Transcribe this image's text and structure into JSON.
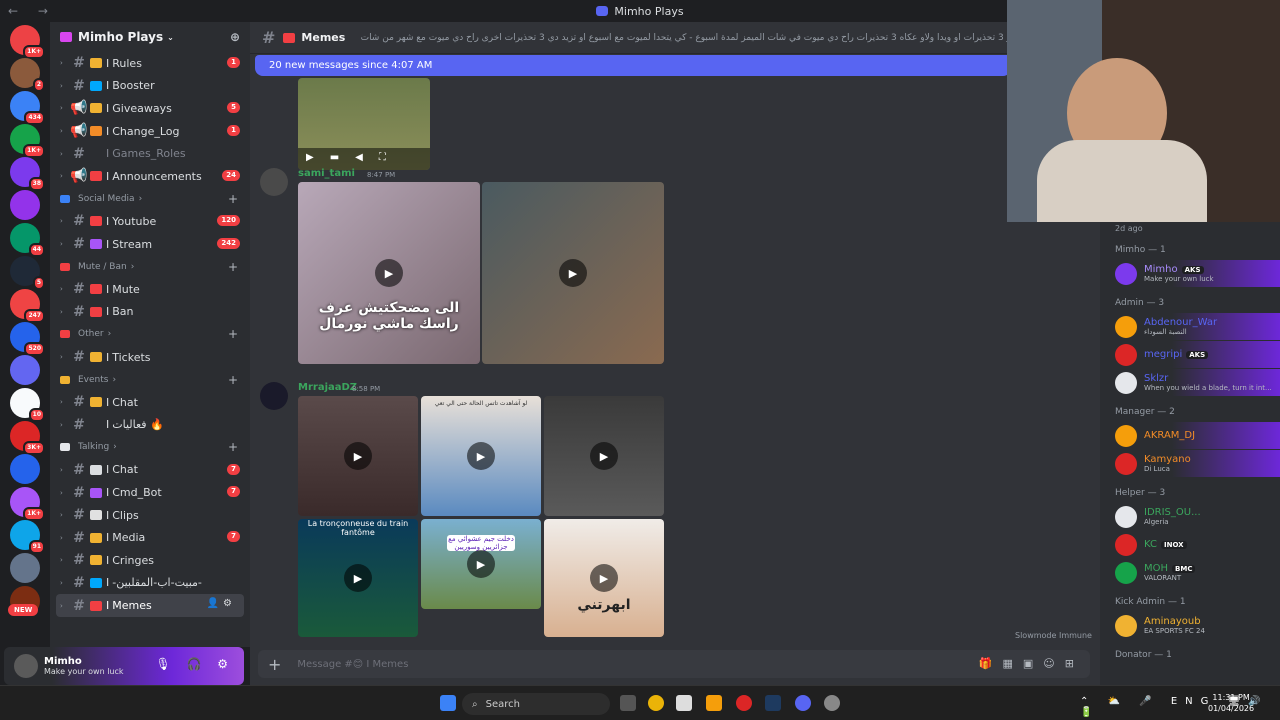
{
  "window": {
    "title": "Mimho Plays"
  },
  "guilds": {
    "badges": [
      "1K+",
      "2",
      "434",
      "1K+",
      "38",
      "",
      "44",
      "5",
      "247",
      "520",
      "",
      "10",
      "3K+",
      "",
      "1K+",
      "91",
      "",
      ""
    ],
    "new_label": "NEW"
  },
  "server": {
    "name": "Mimho Plays"
  },
  "channels": [
    {
      "label": "Rules",
      "type": "text",
      "badge": "1",
      "color": "#f0b232"
    },
    {
      "label": "Booster",
      "type": "text",
      "badge": "",
      "color": "#00a8fc"
    },
    {
      "label": "Giveaways",
      "type": "announce",
      "badge": "5",
      "color": "#f0b232"
    },
    {
      "label": "Change_Log",
      "type": "announce",
      "badge": "1",
      "color": "#f28c28"
    },
    {
      "label": "Games_Roles",
      "type": "text",
      "badge": "",
      "color": "",
      "muted": true
    },
    {
      "label": "Announcements",
      "type": "announce",
      "badge": "24",
      "color": "#f23f43"
    }
  ],
  "categories": {
    "social": {
      "label": "Social Media",
      "items": [
        {
          "label": "Youtube",
          "badge": "120",
          "color": "#f23f43"
        },
        {
          "label": "Stream",
          "badge": "242",
          "color": "#a855f7"
        }
      ]
    },
    "mute": {
      "label": "Mute / Ban",
      "items": [
        {
          "label": "Mute",
          "color": "#f23f43"
        },
        {
          "label": "Ban",
          "color": "#f23f43"
        }
      ]
    },
    "other": {
      "label": "Other",
      "items": [
        {
          "label": "Tickets",
          "color": "#f0b232"
        }
      ]
    },
    "events": {
      "label": "Events",
      "items": [
        {
          "label": "Chat",
          "color": "#f0b232"
        },
        {
          "label": "فعاليات 🔥",
          "color": ""
        }
      ]
    },
    "talking": {
      "label": "Talking",
      "items": [
        {
          "label": "Chat",
          "badge": "7",
          "color": "#dbdee1"
        },
        {
          "label": "Cmd_Bot",
          "badge": "7",
          "color": "#a855f7"
        },
        {
          "label": "Clips",
          "badge": "",
          "color": "#e1e1e1"
        },
        {
          "label": "Media",
          "badge": "7",
          "color": "#f0b232"
        },
        {
          "label": "Cringes",
          "badge": "",
          "color": "#f0b232"
        },
        {
          "label": "-مبيت-اب-المقلبين-",
          "badge": "",
          "color": "#00a8fc"
        },
        {
          "label": "Memes",
          "badge": "",
          "color": "#f23f43",
          "active": true
        }
      ]
    }
  },
  "user": {
    "name": "Mimho",
    "status": "Make your own luck"
  },
  "channel_header": {
    "name": "Memes",
    "topic": "ديرو عقوبات - تمدر 3 تحذيرات او ويدا ولاو عكاه 3 تحذيرات راح دي ميوت في شات الميمز لمدة اسبوع - كي يتحدا لميوت مع اسبوع او تزيد دي 3 تحذيرات أخرى راح دي ميوت مع شهر من شات الميمز ( @75..."
  },
  "new_messages": "20 new messages since 4:07 AM",
  "messages": [
    {
      "author": "sami_tami",
      "time": "8:47 PM",
      "caption": "الى مضحكتيش عرف راسك ماشي نورمال"
    },
    {
      "author": "MrrajaaDZ",
      "time": "8:58 PM",
      "captions": [
        "La tronçonneuse du train fantôme",
        "دخلت جيم عشوائي مع جزائريين وسوريين",
        "ابهرتني",
        "لو آشاهدت تاتس الحالة حتى الي تعي"
      ]
    }
  ],
  "slowmode": "Slowmode Immune",
  "composer": {
    "placeholder": "Message #😊 I Memes"
  },
  "members": {
    "top_time": "2d ago",
    "groups": [
      {
        "label": "Mimho — 1",
        "members": [
          {
            "name": "Mimho",
            "tag": "AKS",
            "status": "Make your own luck",
            "color": "#a78bfa"
          }
        ]
      },
      {
        "label": "Admin — 3",
        "members": [
          {
            "name": "Abdenour_War",
            "tag": "",
            "status": "النصبة السوداء",
            "color": "#5865f2"
          },
          {
            "name": "megripi",
            "tag": "AKS",
            "status": "",
            "color": "#5865f2"
          },
          {
            "name": "Sklzr",
            "tag": "",
            "status": "When you wield a blade, turn it int...",
            "color": "#5865f2"
          }
        ]
      },
      {
        "label": "Manager — 2",
        "members": [
          {
            "name": "AKRAM_DJ",
            "tag": "",
            "status": "",
            "color": "#f28c28"
          },
          {
            "name": "Kamyano",
            "tag": "",
            "status": "Di Luca",
            "color": "#f28c28"
          }
        ]
      },
      {
        "label": "Helper — 3",
        "members": [
          {
            "name": "IDRIS_OU...",
            "tag": "",
            "status": "Algeria",
            "color": "#3ba55d"
          },
          {
            "name": "KC",
            "tag": "INOX",
            "status": "",
            "color": "#3ba55d"
          },
          {
            "name": "MOH",
            "tag": "BMC",
            "status": "VALORANT",
            "color": "#3ba55d"
          }
        ]
      },
      {
        "label": "Kick Admin — 1",
        "members": [
          {
            "name": "Aminayoub",
            "tag": "",
            "status": "EA SPORTS FC 24",
            "color": "#f0b232"
          }
        ]
      },
      {
        "label": "Donator — 1",
        "members": []
      }
    ]
  },
  "taskbar": {
    "search": "Search",
    "lang": "ENG",
    "time": "11:31 PM",
    "date": "01/04/2026"
  }
}
